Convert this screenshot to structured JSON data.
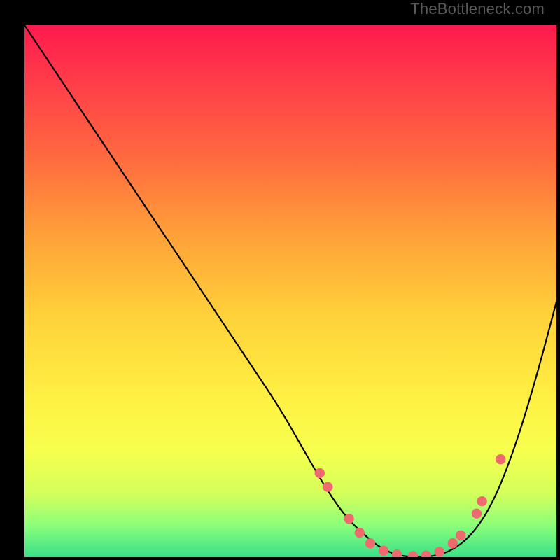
{
  "watermark": "TheBottleneck.com",
  "chart_data": {
    "type": "line",
    "title": "",
    "xlabel": "",
    "ylabel": "",
    "xlim": [
      0,
      100
    ],
    "ylim": [
      0,
      100
    ],
    "series": [
      {
        "name": "curve",
        "x": [
          0,
          6,
          12,
          18,
          24,
          30,
          36,
          42,
          48,
          52,
          56,
          60,
          64,
          68,
          72,
          76,
          80,
          84,
          88,
          92,
          96,
          100
        ],
        "y": [
          100,
          91,
          82,
          73,
          64,
          55,
          46,
          37,
          28,
          21,
          14,
          8,
          4,
          1,
          0,
          0,
          1,
          4,
          10,
          20,
          33,
          48
        ]
      }
    ],
    "markers": [
      {
        "x": 55.5,
        "y": 15.8
      },
      {
        "x": 57.0,
        "y": 13.2
      },
      {
        "x": 61.0,
        "y": 7.2
      },
      {
        "x": 63.0,
        "y": 4.6
      },
      {
        "x": 65.0,
        "y": 2.6
      },
      {
        "x": 67.5,
        "y": 1.2
      },
      {
        "x": 70.0,
        "y": 0.5
      },
      {
        "x": 73.0,
        "y": 0.2
      },
      {
        "x": 75.5,
        "y": 0.3
      },
      {
        "x": 78.0,
        "y": 1.0
      },
      {
        "x": 80.5,
        "y": 2.6
      },
      {
        "x": 82.0,
        "y": 4.1
      },
      {
        "x": 85.0,
        "y": 8.2
      },
      {
        "x": 86.0,
        "y": 10.5
      },
      {
        "x": 89.5,
        "y": 18.4
      }
    ],
    "marker_color": "#ef6a6f",
    "curve_color": "#000000"
  }
}
